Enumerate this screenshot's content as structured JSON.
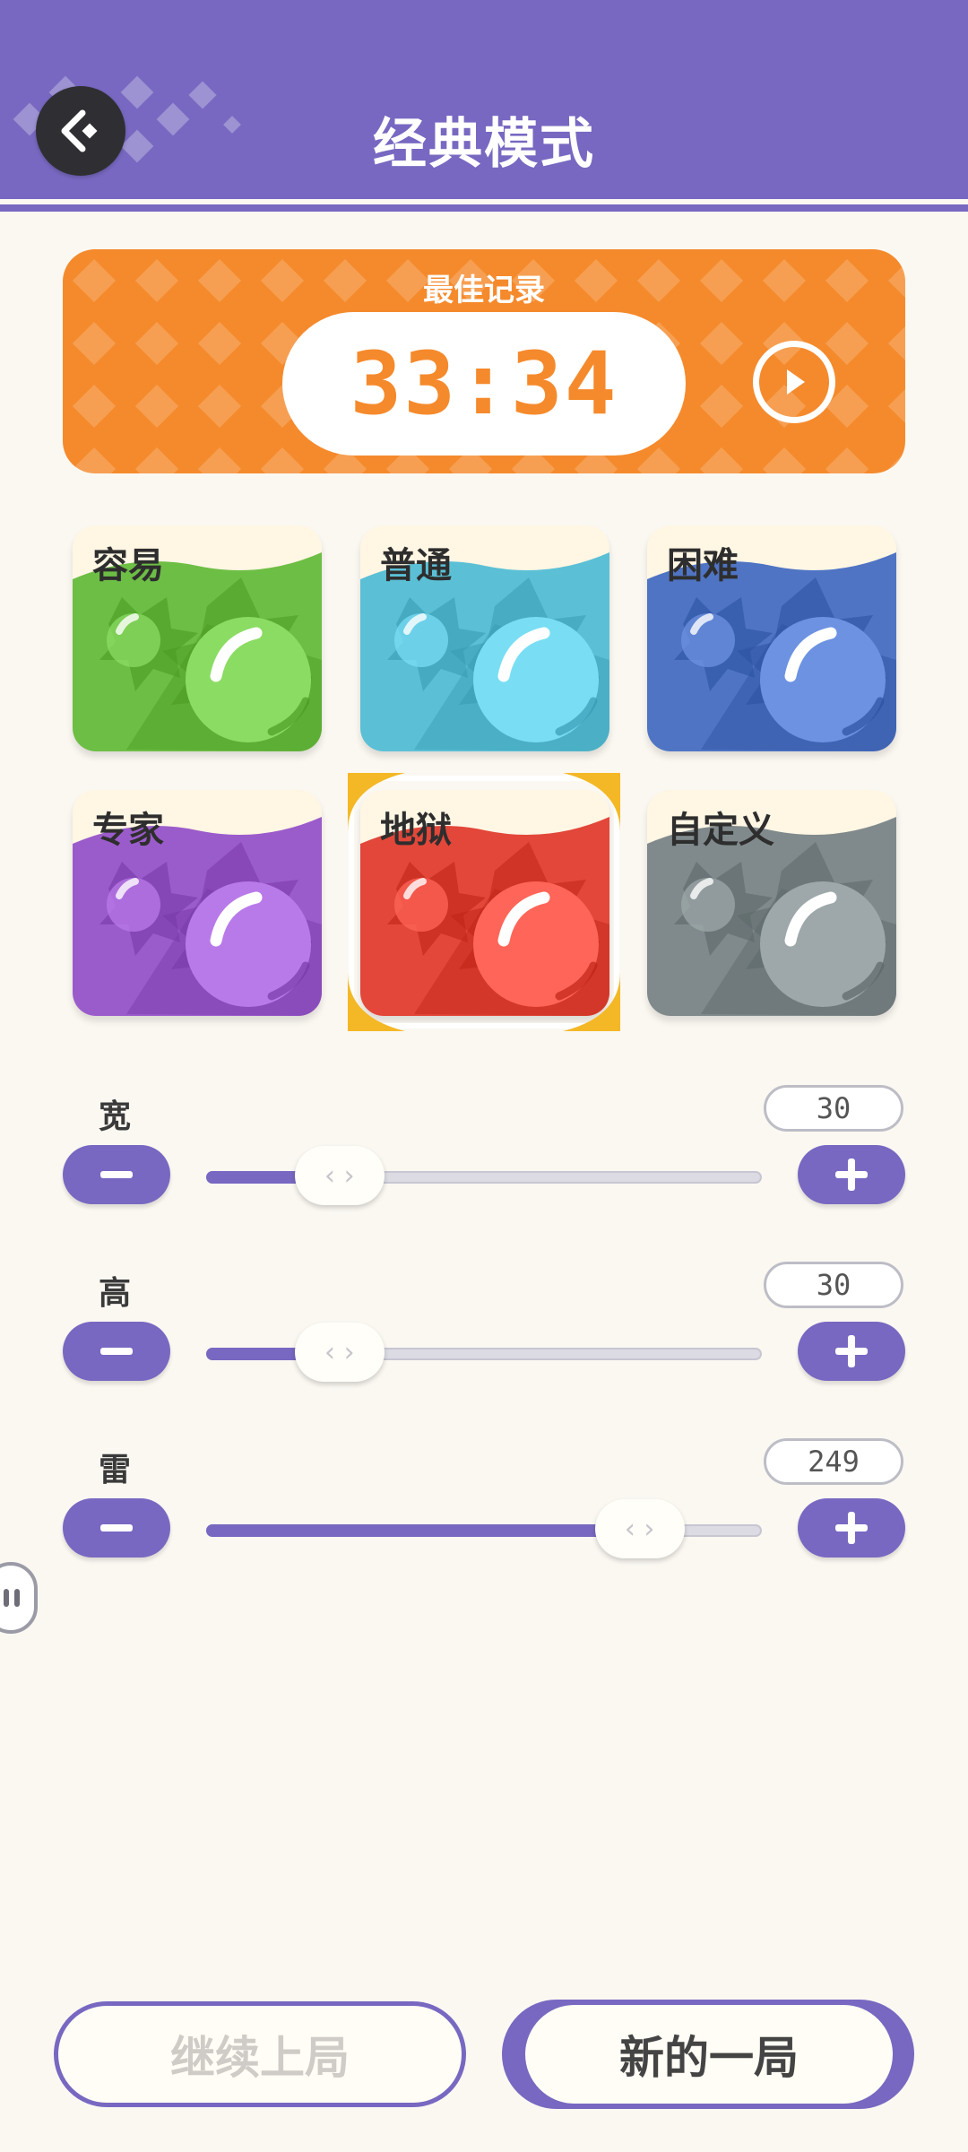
{
  "header": {
    "title": "经典模式",
    "back_icon": "back-diamond-icon",
    "color": "#7868C1"
  },
  "best_record": {
    "label": "最佳记录",
    "time": "33:34",
    "play_icon": "play-circle-icon",
    "color": "#F58A2C"
  },
  "difficulties": [
    {
      "label": "容易",
      "color": "#6DBE45",
      "selected": false
    },
    {
      "label": "普通",
      "color": "#5BC0D6",
      "selected": false
    },
    {
      "label": "困难",
      "color": "#4F74C4",
      "selected": false
    },
    {
      "label": "专家",
      "color": "#9B5CCB",
      "selected": false
    },
    {
      "label": "地狱",
      "color": "#E2473A",
      "selected": true
    },
    {
      "label": "自定义",
      "color": "#808A8C",
      "selected": false
    }
  ],
  "settings": {
    "width": {
      "label": "宽",
      "value": "30",
      "fraction": 0.24
    },
    "height": {
      "label": "高",
      "value": "30",
      "fraction": 0.24
    },
    "mines": {
      "label": "雷",
      "value": "249",
      "fraction": 0.78
    },
    "minus_icon": "minus-icon",
    "plus_icon": "plus-icon",
    "thumb_icon": "‹ ›"
  },
  "buttons": {
    "continue": "继续上局",
    "new_game": "新的一局"
  }
}
